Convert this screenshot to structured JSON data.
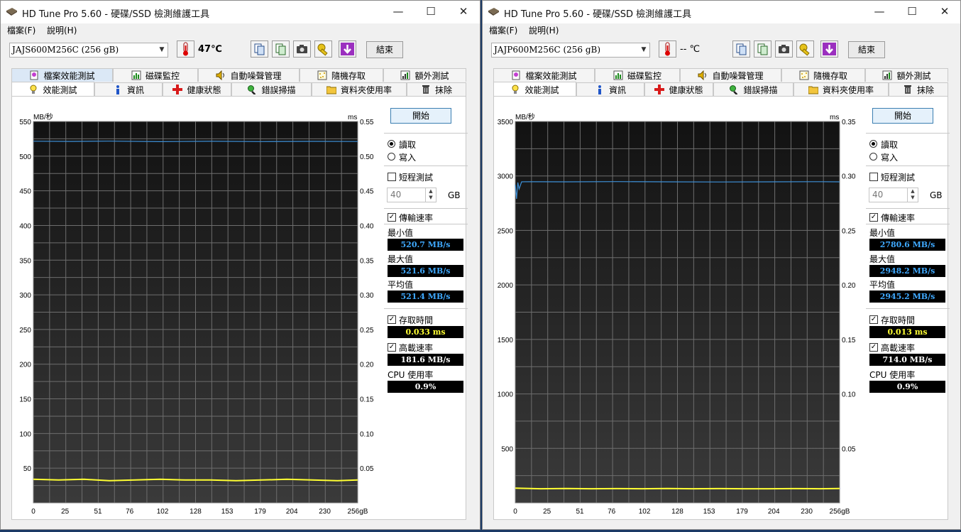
{
  "windows": [
    {
      "title": "HD Tune Pro 5.60 - 硬碟/SSD 檢測維護工具",
      "menu": [
        "檔案(F)",
        "說明(H)"
      ],
      "drive": "JAJS600M256C (256 gB)",
      "temperature": "47℃",
      "exit_label": "結束",
      "tabs_row1": [
        "檔案效能測試",
        "磁碟監控",
        "自動噪聲管理",
        "隨機存取",
        "額外測試"
      ],
      "tabs_row2": [
        "效能測試",
        "資訊",
        "健康狀態",
        "錯誤掃描",
        "資料夾使用率",
        "抹除"
      ],
      "start_label": "開始",
      "read_label": "讀取",
      "write_label": "寫入",
      "short_test_label": "短程測試",
      "short_test_value": "40",
      "gb_label": "GB",
      "transfer_label": "傳輸速率",
      "min_label": "最小值",
      "min_value": "520.7 MB/s",
      "max_label": "最大值",
      "max_value": "521.6 MB/s",
      "avg_label": "平均值",
      "avg_value": "521.4 MB/s",
      "access_label": "存取時間",
      "access_value": "0.033 ms",
      "burst_label": "高載速率",
      "burst_value": "181.6 MB/s",
      "cpu_label": "CPU 使用率",
      "cpu_value": "0.9%",
      "chart_data": {
        "type": "line",
        "ylabel_left": "MB/秒",
        "ylabel_right": "ms",
        "yticks_left": [
          "550",
          "500",
          "450",
          "400",
          "350",
          "300",
          "250",
          "200",
          "150",
          "100",
          "50"
        ],
        "yticks_right": [
          "0.55",
          "0.50",
          "0.45",
          "0.40",
          "0.35",
          "0.30",
          "0.25",
          "0.20",
          "0.15",
          "0.10",
          "0.05"
        ],
        "xticks": [
          "0",
          "25",
          "51",
          "76",
          "102",
          "128",
          "153",
          "179",
          "204",
          "230",
          "256gB"
        ],
        "ylim_left": [
          0,
          550
        ],
        "ylim_right": [
          0,
          0.55
        ],
        "xlim": [
          0,
          256
        ],
        "grid": true,
        "series": [
          {
            "color": "#3d8fd6",
            "x": [
              0,
              30,
              60,
              100,
              140,
              180,
              220,
              256
            ],
            "y": [
              521.5,
              521.2,
              521.6,
              520.9,
              521.4,
              521.0,
              521.3,
              521.1
            ]
          },
          {
            "color": "#ffff33",
            "x": [
              0,
              20,
              40,
              60,
              80,
              100,
              120,
              140,
              160,
              180,
              200,
              220,
              240,
              256
            ],
            "y": [
              0.034,
              0.033,
              0.034,
              0.032,
              0.033,
              0.034,
              0.033,
              0.033,
              0.032,
              0.033,
              0.034,
              0.033,
              0.032,
              0.033
            ]
          }
        ]
      }
    },
    {
      "title": "HD Tune Pro 5.60 - 硬碟/SSD 檢測維護工具",
      "menu": [
        "檔案(F)",
        "說明(H)"
      ],
      "drive": "JAJP600M256C (256 gB)",
      "temperature": "-- ℃",
      "exit_label": "結束",
      "tabs_row1": [
        "檔案效能測試",
        "磁碟監控",
        "自動噪聲管理",
        "隨機存取",
        "額外測試"
      ],
      "tabs_row2": [
        "效能測試",
        "資訊",
        "健康狀態",
        "錯誤掃描",
        "資料夾使用率",
        "抹除"
      ],
      "start_label": "開始",
      "read_label": "讀取",
      "write_label": "寫入",
      "short_test_label": "短程測試",
      "short_test_value": "40",
      "gb_label": "GB",
      "transfer_label": "傳輸速率",
      "min_label": "最小值",
      "min_value": "2780.6 MB/s",
      "max_label": "最大值",
      "max_value": "2948.2 MB/s",
      "avg_label": "平均值",
      "avg_value": "2945.2 MB/s",
      "access_label": "存取時間",
      "access_value": "0.013 ms",
      "burst_label": "高載速率",
      "burst_value": "714.0 MB/s",
      "cpu_label": "CPU 使用率",
      "cpu_value": "0.9%",
      "chart_data": {
        "type": "line",
        "ylabel_left": "MB/秒",
        "ylabel_right": "ms",
        "yticks_left": [
          "3500",
          "3000",
          "2500",
          "2000",
          "1500",
          "1000",
          "500"
        ],
        "yticks_right": [
          "0.35",
          "0.30",
          "0.25",
          "0.20",
          "0.15",
          "0.10",
          "0.05"
        ],
        "xticks": [
          "0",
          "25",
          "51",
          "76",
          "102",
          "128",
          "153",
          "179",
          "204",
          "230",
          "256gB"
        ],
        "ylim_left": [
          0,
          3500
        ],
        "ylim_right": [
          0,
          0.35
        ],
        "xlim": [
          0,
          256
        ],
        "grid": true,
        "series": [
          {
            "color": "#3d8fd6",
            "x": [
              0,
              1,
              2,
              3,
              5,
              10,
              40,
              80,
              120,
              160,
              200,
              240,
              256
            ],
            "y": [
              2920,
              2790,
              2940,
              2880,
              2946,
              2947,
              2946,
              2948,
              2946,
              2945,
              2946,
              2947,
              2946
            ]
          },
          {
            "color": "#ffff33",
            "x": [
              0,
              20,
              40,
              60,
              80,
              100,
              120,
              140,
              160,
              180,
              200,
              220,
              240,
              256
            ],
            "y": [
              0.0135,
              0.013,
              0.0132,
              0.013,
              0.0131,
              0.013,
              0.0132,
              0.013,
              0.0131,
              0.013,
              0.013,
              0.0131,
              0.013,
              0.0132
            ]
          }
        ]
      }
    }
  ]
}
